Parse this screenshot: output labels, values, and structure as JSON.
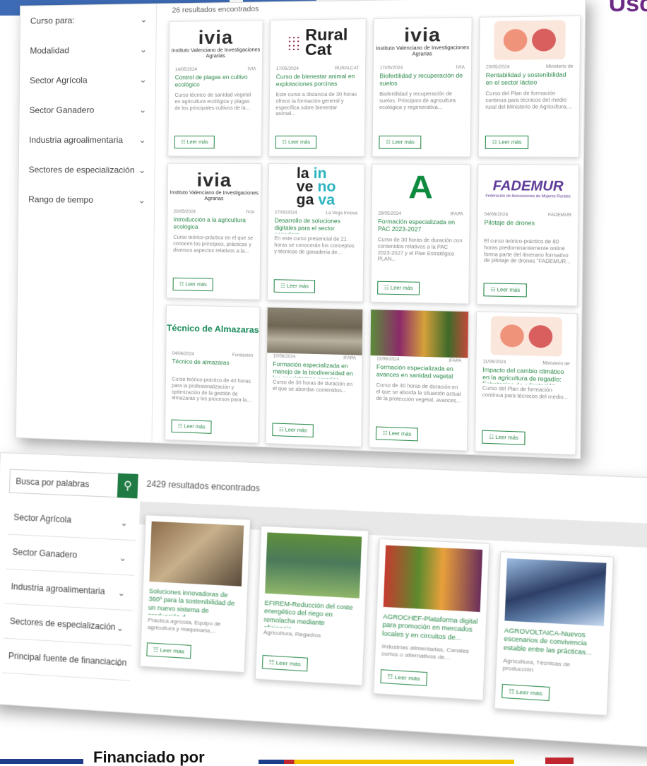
{
  "header": {
    "title_fragment": "Usc"
  },
  "panel_a": {
    "results": "26 resultados encontrados",
    "filters": [
      {
        "label": "Curso para:"
      },
      {
        "label": "Modalidad"
      },
      {
        "label": "Sector Agrícola"
      },
      {
        "label": "Sector Ganadero"
      },
      {
        "label": "Industria agroalimentaria"
      },
      {
        "label": "Sectores de especialización"
      },
      {
        "label": "Rango de tiempo"
      }
    ],
    "cards": [
      {
        "date": "14/05/2024",
        "source": "IVIA",
        "title": "Control de plagas en cultivo ecológico",
        "desc": "Curso técnico de sanidad vegetal en agricultura ecológica y plagas de los principales cultivos de la...",
        "logo": "ivia"
      },
      {
        "date": "17/05/2024",
        "source": "RURALCAT",
        "title": "Curso de bienestar animal en explotaciones porcinas",
        "desc": "Este curso a distancia de 30 horas ofrece la formación general y específica sobre bienestar animal...",
        "logo": "ruralcat"
      },
      {
        "date": "17/05/2024",
        "source": "IVIA",
        "title": "Biofertilidad y recuperación de suelos",
        "desc": "Biofertilidad y recuperación de suelos. Principios de agricultura ecológica y regenerativa...",
        "logo": "ivia"
      },
      {
        "date": "20/05/2024",
        "source": "Ministerio de",
        "title": "Rentabilidad y sostenibilidad en el sector lácteo",
        "desc": "Curso del Plan de formación continua para técnicos del medio rural del Ministerio de Agricultura,...",
        "logo": "faces"
      },
      {
        "date": "20/05/2024",
        "source": "IVIA",
        "title": "Introducción a la agricultura ecológica",
        "desc": "Curso teórico-práctico en el que se conocen los principios, prácticas y diversos aspectos relativos a la...",
        "logo": "ivia"
      },
      {
        "date": "27/05/2024",
        "source": "La Vega Innova",
        "title": "Desarrollo de soluciones digitales para el sector ganadero",
        "desc": "En este curso presencial de 21 horas se conocerán los conceptos y técnicas de ganadería de...",
        "logo": "vega"
      },
      {
        "date": "28/05/2024",
        "source": "IFAPA",
        "title": "Formación especializada en PAC 2023-2027",
        "desc": "Curso de 30 horas de duración con contenidos relativos a la PAC 2023-2027 y el Plan Estratégico PLAN...",
        "logo": "andalucia"
      },
      {
        "date": "04/06/2024",
        "source": "FADEMUR",
        "title": "Pilotaje de drones",
        "desc": "El curso teórico-práctico de 80 horas predominantemente online forma parte del itinerario formativo de pilotaje de drones \"FADEMUR...",
        "logo": "fademur"
      },
      {
        "date": "04/06/2024",
        "source": "Fundación",
        "title": "Técnico de almazaras",
        "desc": "Curso teórico-práctico de 40 horas para la profesionalización y optimización de la gestión de almazaras y los procesos para la...",
        "logo": "almazaras"
      },
      {
        "date": "10/06/2024",
        "source": "IFAPA",
        "title": "Formación especializada en manejo de la biodiversidad en los ecosistemas agrarios",
        "desc": "Curso de 30 horas de duración en el que se abordan contenidos...",
        "logo": "soil"
      },
      {
        "date": "11/06/2024",
        "source": "IFAPA",
        "title": "Formación especializada en avances en sanidad vegetal",
        "desc": "Curso de 30 horas de duración en el que se aborda la situación actual de la protección vegetal, avances...",
        "logo": "veg"
      },
      {
        "date": "11/06/2024",
        "source": "Ministerio de",
        "title": "Impacto del cambio climático en la agricultura de regadío: Estrategias de adaptación",
        "desc": "Curso del Plan de formación continua para técnicos del medio...",
        "logo": "faces"
      }
    ],
    "logos": {
      "ivia": "ivia",
      "ivia_sub": "Instituto Valenciano de Investigaciones Agrarias",
      "rural": "Rural",
      "cat": "Cat",
      "vega_1": "la",
      "vega_2": "ve",
      "vega_3": "ga",
      "vega_4": "in",
      "vega_5": "no",
      "vega_6": "va",
      "andalucia": "A",
      "fademur": "FADEMUR",
      "fademur_sub": "Federación de Asociaciones de Mujeres Rurales",
      "almazaras": "Técnico de Almazaras"
    },
    "leer_mas": "Leer más"
  },
  "panel_b": {
    "search_placeholder": "Busca por palabras",
    "search_icon": "search-icon",
    "results": "2429 resultados encontrados",
    "filters": [
      {
        "label": "Sector Agrícola"
      },
      {
        "label": "Sector Ganadero"
      },
      {
        "label": "Industria agroalimentaria"
      },
      {
        "label": "Sectores de especialización"
      },
      {
        "label": "Principal fuente de financiación"
      }
    ],
    "cards": [
      {
        "title": "Soluciones innovadoras de 360º para la sostenibilidad de un nuevo sistema de producción d...",
        "desc": "Práctica agrícola, Equipo de agricultura y maquinaria,..."
      },
      {
        "title": "EFIREM-Reducción del coste energético del riego en remolacha mediante eficiencia...",
        "desc": "Agricultura, Regadíos"
      },
      {
        "title": "AGROCHEF-Plataforma digital para promoción en mercados locales y en circuitos de...",
        "desc": "Industrias alimentarias, Canales cortos o alternativos de..."
      },
      {
        "title": "AGROVOLTAICA-Nuevos escenarios de convivencia estable entre las prácticas...",
        "desc": "Agricultura, Técnicas de producción"
      }
    ],
    "leer_mas": "Leer más"
  },
  "footer": {
    "financiado": "Financiado por"
  },
  "colors": {
    "accent_green": "#2b8a4a",
    "search_green": "#1f7a43",
    "bar_blue": "#3d6bb5",
    "title_purple": "#6d2b86"
  }
}
